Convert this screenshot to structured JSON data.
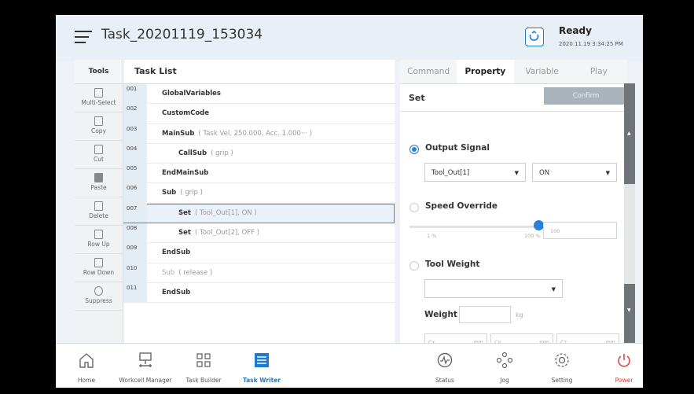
{
  "header": {
    "title": "Task_20201119_153034",
    "status": "Ready",
    "datetime": "2020.11.19 3:34:25 PM"
  },
  "tools": {
    "heading": "Tools",
    "items": [
      {
        "label": "Multi-Select",
        "icon": "multi-select-icon"
      },
      {
        "label": "Copy",
        "icon": "copy-icon"
      },
      {
        "label": "Cut",
        "icon": "cut-icon"
      },
      {
        "label": "Paste",
        "icon": "paste-icon"
      },
      {
        "label": "Delete",
        "icon": "delete-icon"
      },
      {
        "label": "Row Up",
        "icon": "row-up-icon"
      },
      {
        "label": "Row Down",
        "icon": "row-down-icon"
      },
      {
        "label": "Suppress",
        "icon": "suppress-icon"
      }
    ]
  },
  "tasklist": {
    "heading": "Task List",
    "rows": [
      {
        "num": "001",
        "text": "GlobalVariables",
        "param": "",
        "indent": 0
      },
      {
        "num": "002",
        "text": "CustomCode",
        "param": "",
        "indent": 0
      },
      {
        "num": "003",
        "text": "MainSub",
        "param": "( Task Vel. 250.000, Acc. 1.000··· )",
        "indent": 0
      },
      {
        "num": "004",
        "text": "CallSub",
        "param": "( grip )",
        "indent": 1
      },
      {
        "num": "005",
        "text": "EndMainSub",
        "param": "",
        "indent": 0
      },
      {
        "num": "006",
        "text": "Sub",
        "param": "( grip )",
        "indent": 0
      },
      {
        "num": "007",
        "text": "Set",
        "param": "( Tool_Out[1], ON )",
        "indent": 1,
        "selected": true
      },
      {
        "num": "008",
        "text": "Set",
        "param": "( Tool_Out[2], OFF )",
        "indent": 1
      },
      {
        "num": "009",
        "text": "EndSub",
        "param": "",
        "indent": 0
      },
      {
        "num": "010",
        "text": "Sub",
        "param": "( release )",
        "indent": 0,
        "dim": true
      },
      {
        "num": "011",
        "text": "EndSub",
        "param": "",
        "indent": 0
      }
    ]
  },
  "panel": {
    "tabs": [
      "Command",
      "Property",
      "Variable",
      "Play"
    ],
    "active_tab": "Property",
    "set_title": "Set",
    "confirm": "Confirm",
    "output_signal": {
      "label": "Output Signal",
      "signal": "Tool_Out[1]",
      "value": "ON"
    },
    "speed_override": {
      "label": "Speed Override",
      "min": "1 %",
      "max": "100 %",
      "input": "100",
      "level": 1.0
    },
    "tool_weight": {
      "label": "Tool Weight",
      "weight_label": "Weight",
      "weight_unit": "kg",
      "cx": "Cx",
      "cy": "Cy",
      "cz": "Cz",
      "unit": "mm"
    }
  },
  "bottom_nav": {
    "left": [
      {
        "label": "Home",
        "icon": "home-icon"
      },
      {
        "label": "Workcell Manager",
        "icon": "workcell-manager-icon"
      },
      {
        "label": "Task Builder",
        "icon": "task-builder-icon"
      },
      {
        "label": "Task Writer",
        "icon": "task-writer-icon",
        "active": true
      }
    ],
    "right": [
      {
        "label": "Status",
        "icon": "status-icon"
      },
      {
        "label": "Jog",
        "icon": "jog-icon"
      },
      {
        "label": "Setting",
        "icon": "setting-icon"
      },
      {
        "label": "Power",
        "icon": "power-icon"
      }
    ]
  },
  "colors": {
    "accent": "#1a7ad4",
    "power": "#e23b3b",
    "selected_row": "#eaf1f9"
  }
}
